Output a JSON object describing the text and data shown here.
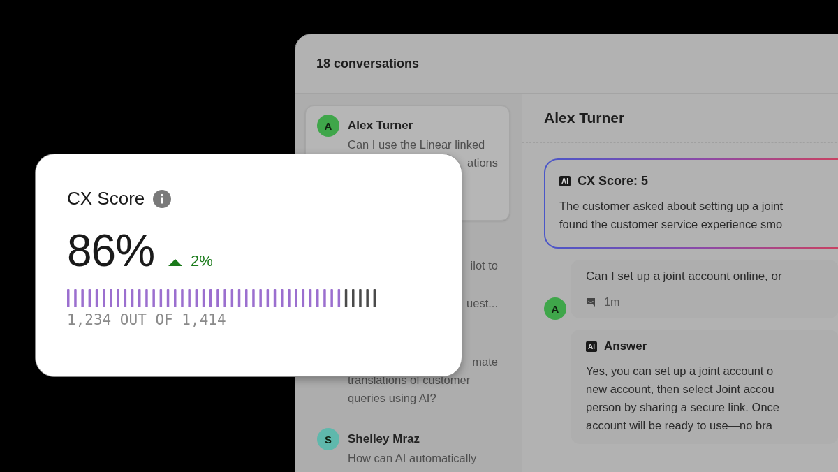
{
  "window": {
    "title": "18 conversations"
  },
  "conversations": [
    {
      "name": "Alex Turner",
      "avatar": "A",
      "color": "#3fa64a",
      "selected": true,
      "lines": [
        {
          "kind": "full",
          "text": "Can I use the Linear linked"
        },
        {
          "kind": "partial",
          "text": "ations"
        }
      ]
    },
    {
      "selected": false,
      "lines": [
        {
          "kind": "partial",
          "text": "ilot to"
        },
        {
          "kind": "gap"
        },
        {
          "kind": "partial",
          "text": "uest..."
        }
      ]
    },
    {
      "selected": false,
      "lines": [
        {
          "kind": "partial",
          "text": "mate"
        },
        {
          "kind": "full",
          "text": "translations of customer"
        },
        {
          "kind": "full",
          "text": "queries using AI?"
        }
      ]
    },
    {
      "name": "Shelley Mraz",
      "avatar": "S",
      "color": "#5fb8ac",
      "selected": false,
      "lines": [
        {
          "kind": "full",
          "text": "How can AI automatically"
        }
      ]
    }
  ],
  "detail": {
    "title": "Alex Turner",
    "summary": {
      "badge": "AI",
      "title": "CX Score: 5",
      "lines": [
        "The customer asked about setting up a joint",
        "found the customer service experience smo"
      ]
    },
    "message": {
      "text": "Can I set up a joint account online, or",
      "time": "1m",
      "avatar": "A",
      "color": "#3fa64a"
    },
    "answer": {
      "badge": "AI",
      "title": "Answer",
      "lines": [
        "Yes, you can set up a joint account o",
        "new account, then select Joint accou",
        "person by sharing a secure link. Once",
        "account will be ready to use—no bra"
      ]
    }
  },
  "score_card": {
    "title": "CX Score",
    "value": "86%",
    "trend": "2%",
    "trend_up": true,
    "level": 0.88,
    "caption": "1,234 OUT OF 1,414"
  }
}
